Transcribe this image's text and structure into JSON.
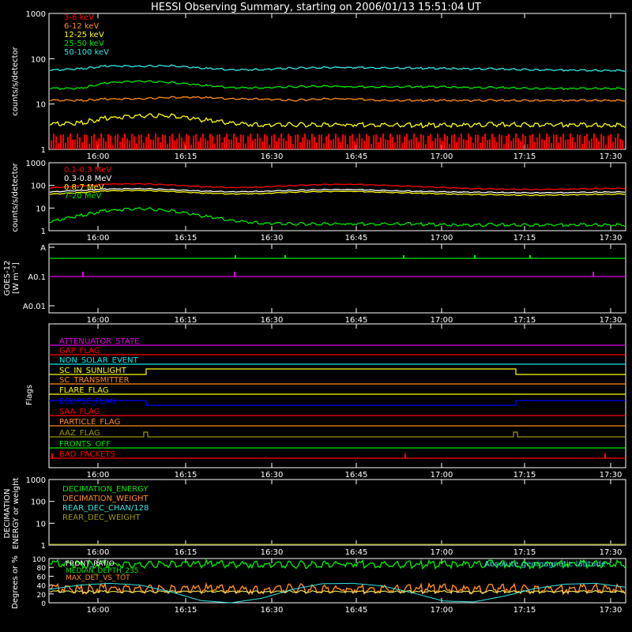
{
  "title": "HESSI Observing Summary, starting on 2006/01/13 15:51:04 UT",
  "time_ticks": [
    "16:00",
    "16:15",
    "16:30",
    "16:45",
    "17:00",
    "17:15",
    "17:30"
  ],
  "colors": {
    "red": "#ff0000",
    "orange": "#ff8c1a",
    "yellow": "#ffff00",
    "green": "#00e600",
    "cyan": "#33e6e6",
    "magenta": "#e600e6",
    "blue": "#0000ff",
    "white": "#ffffff",
    "olive": "#999900",
    "axis": "#ffffff"
  },
  "chart_data": [
    {
      "id": "low-energy",
      "type": "line",
      "ylabel": "counts/s/detector",
      "yscale": "log",
      "ylim": [
        1,
        1000
      ],
      "yticks": [
        "1",
        "10",
        "100",
        "1000"
      ],
      "series": [
        {
          "name": "3-6 keV",
          "color": "#ff0000",
          "values": [
            1.8,
            1.5,
            2.0,
            1.6,
            1.9,
            1.7,
            1.5,
            1.8,
            1.6,
            1.5,
            1.7,
            1.6,
            1.5,
            1.6,
            1.5,
            1.7,
            1.6,
            1.5,
            1.6,
            1.5
          ]
        },
        {
          "name": "6-12 keV",
          "color": "#ff8c1a",
          "values": [
            12,
            12,
            13,
            13,
            14,
            14,
            13,
            13,
            12,
            13,
            13,
            12,
            12,
            12,
            12,
            12,
            12,
            12,
            12,
            12
          ]
        },
        {
          "name": "12-25 keV",
          "color": "#ffff00",
          "values": [
            3.5,
            3.8,
            5.0,
            5.5,
            5.5,
            4.5,
            3.8,
            3.5,
            3.5,
            3.5,
            3.5,
            3.5,
            3.4,
            3.4,
            3.5,
            3.5,
            3.5,
            3.5,
            3.4,
            3.4
          ]
        },
        {
          "name": "25-50 keV",
          "color": "#00e600",
          "values": [
            22,
            22,
            30,
            32,
            30,
            26,
            23,
            23,
            24,
            25,
            24,
            24,
            24,
            24,
            23,
            23,
            22,
            22,
            22,
            22
          ]
        },
        {
          "name": "50-100 keV",
          "color": "#33e6e6",
          "values": [
            55,
            60,
            70,
            68,
            70,
            62,
            57,
            58,
            62,
            64,
            64,
            63,
            62,
            61,
            60,
            59,
            57,
            56,
            55,
            55
          ]
        }
      ]
    },
    {
      "id": "high-energy",
      "type": "line",
      "ylabel": "counts/s/detector",
      "yscale": "log",
      "ylim": [
        1,
        1000
      ],
      "yticks": [
        "1",
        "10",
        "100",
        "1000"
      ],
      "series": [
        {
          "name": "0.1-0.3 MeV",
          "color": "#ff0000",
          "values": [
            75,
            95,
            115,
            118,
            105,
            88,
            80,
            85,
            98,
            110,
            112,
            102,
            90,
            80,
            72,
            68,
            66,
            68,
            72,
            75
          ]
        },
        {
          "name": "0.3-0.8 MeV",
          "color": "#ffffff",
          "values": [
            50,
            60,
            70,
            72,
            65,
            56,
            52,
            55,
            60,
            65,
            66,
            60,
            55,
            52,
            50,
            48,
            47,
            48,
            50,
            52
          ]
        },
        {
          "name": "0.8-7 MeV",
          "color": "#ffff00",
          "values": [
            40,
            48,
            58,
            60,
            54,
            46,
            42,
            44,
            50,
            54,
            55,
            50,
            46,
            42,
            40,
            38,
            37,
            38,
            40,
            42
          ]
        },
        {
          "name": "7-20 MeV",
          "color": "#00e600",
          "values": [
            2.2,
            4.5,
            8.0,
            9.5,
            7.5,
            4.5,
            2.8,
            2.2,
            2.0,
            2.0,
            2.0,
            2.0,
            2.0,
            1.8,
            1.8,
            1.8,
            1.8,
            1.8,
            1.8,
            1.8
          ]
        }
      ]
    },
    {
      "id": "goes",
      "type": "line",
      "ylabel": "GOES-12",
      "ylabel2": "[W m⁻²]",
      "yticks": [
        "A",
        "A0.1",
        "A0.01"
      ],
      "series": [
        {
          "name": "",
          "color": "#00e600",
          "level": "A"
        },
        {
          "name": "",
          "color": "#e600e6",
          "level": "A0.1"
        }
      ]
    },
    {
      "id": "flags",
      "type": "line",
      "ylabel": "Flags",
      "series": [
        {
          "name": "ATTENUATOR_STATE",
          "color": "#e600e6"
        },
        {
          "name": "GAP_FLAG",
          "color": "#ff0000"
        },
        {
          "name": "NON_SOLAR_EVENT",
          "color": "#00e6e6"
        },
        {
          "name": "SC_IN_SUNLIGHT",
          "color": "#ffff00"
        },
        {
          "name": "SC_TRANSMITTER",
          "color": "#ff8c1a"
        },
        {
          "name": "FLARE_FLAG",
          "color": "#ffff00"
        },
        {
          "name": "ECLIPSE_FLAG",
          "color": "#0000ff"
        },
        {
          "name": "SAA_FLAG",
          "color": "#ff0000"
        },
        {
          "name": "PARTICLE_FLAG",
          "color": "#ff8c1a"
        },
        {
          "name": "AAZ_FLAG",
          "color": "#999900"
        },
        {
          "name": "FRONTS_OFF",
          "color": "#00e600"
        },
        {
          "name": "BAD_PACKETS",
          "color": "#ff0000"
        }
      ]
    },
    {
      "id": "decimation",
      "type": "line",
      "ylabel": "DECIMATION",
      "ylabel2": "ENERGY or weight",
      "yscale": "log",
      "ylim": [
        1,
        1000
      ],
      "yticks": [
        "1",
        "10",
        "100",
        "1000"
      ],
      "series": [
        {
          "name": "DECIMATION_ENERGY",
          "color": "#00e600"
        },
        {
          "name": "DECIMATION_WEIGHT",
          "color": "#ff8c1a"
        },
        {
          "name": "REAR_DEC_CHAN/128",
          "color": "#33e6e6"
        },
        {
          "name": "REAR_DEC_WEIGHT",
          "color": "#999900"
        }
      ]
    },
    {
      "id": "geo",
      "type": "line",
      "ylabel": "Degrees or %",
      "ylim": [
        0,
        100
      ],
      "yticks": [
        "0",
        "20",
        "40",
        "60",
        "80",
        "100"
      ],
      "annotation": "Absolute geomagnetic latitude",
      "series": [
        {
          "name": "FRONT_RATIO",
          "color": "#ffffff",
          "values": [
            25,
            25,
            25,
            25,
            25,
            25,
            25,
            25,
            25,
            25,
            25,
            25,
            25,
            25,
            25,
            25,
            25,
            25,
            25,
            25
          ]
        },
        {
          "name": "MEDIAN_DEPTH_235",
          "color": "#00e600",
          "values": [
            88,
            87,
            88,
            86,
            87,
            88,
            87,
            88,
            86,
            87,
            88,
            87,
            86,
            87,
            88,
            87,
            86,
            88,
            87,
            88
          ]
        },
        {
          "name": "MAX_DET_VS_TOT",
          "color": "#ff8c1a",
          "values": [
            32,
            30,
            33,
            31,
            30,
            32,
            31,
            30,
            33,
            31,
            30,
            32,
            31,
            33,
            30,
            32,
            31,
            30,
            32,
            31
          ]
        }
      ],
      "latitude": [
        30,
        40,
        44,
        40,
        25,
        5,
        0,
        10,
        30,
        43,
        44,
        38,
        22,
        4,
        2,
        15,
        32,
        42,
        44,
        35
      ]
    }
  ]
}
